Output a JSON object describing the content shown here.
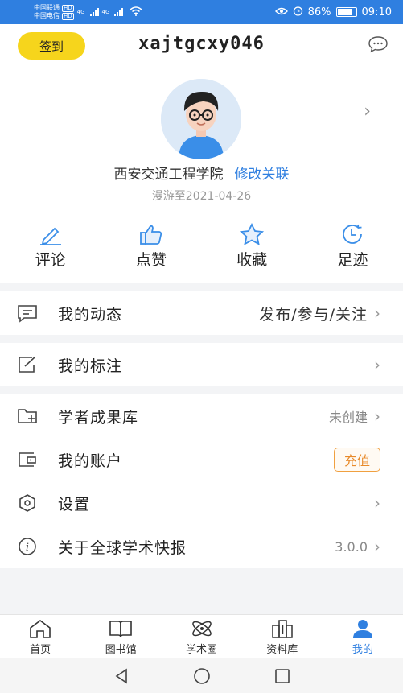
{
  "status": {
    "carrier1": "中国联通",
    "carrier2": "中国电信",
    "hd": "HD",
    "net1": "4G",
    "net2": "4G",
    "battery": "86%",
    "battery_level": 0.86,
    "time": "09:10"
  },
  "header": {
    "signin_label": "签到",
    "username": "xajtgcxy046"
  },
  "profile": {
    "school": "西安交通工程学院",
    "edit_link": "修改关联",
    "roam_text": "漫游至2021-04-26"
  },
  "quick_actions": [
    {
      "label": "评论",
      "icon": "pencil-icon"
    },
    {
      "label": "点赞",
      "icon": "thumbs-up-icon"
    },
    {
      "label": "收藏",
      "icon": "star-icon"
    },
    {
      "label": "足迹",
      "icon": "history-clock-icon"
    }
  ],
  "menu": {
    "dynamics": {
      "label": "我的动态",
      "value": "发布/参与/关注"
    },
    "annotations": {
      "label": "我的标注"
    },
    "scholar": {
      "label": "学者成果库",
      "value": "未创建"
    },
    "account": {
      "label": "我的账户",
      "action": "充值"
    },
    "settings": {
      "label": "设置"
    },
    "about": {
      "label": "关于全球学术快报",
      "value": "3.0.0"
    }
  },
  "tabs": [
    {
      "label": "首页",
      "icon": "home-icon"
    },
    {
      "label": "图书馆",
      "icon": "book-icon"
    },
    {
      "label": "学术圈",
      "icon": "atom-icon"
    },
    {
      "label": "资料库",
      "icon": "building-icon"
    },
    {
      "label": "我的",
      "icon": "person-icon",
      "active": true
    }
  ],
  "colors": {
    "accent": "#2f7fe0",
    "signin": "#f6d51c",
    "recharge": "#e88a2a"
  }
}
